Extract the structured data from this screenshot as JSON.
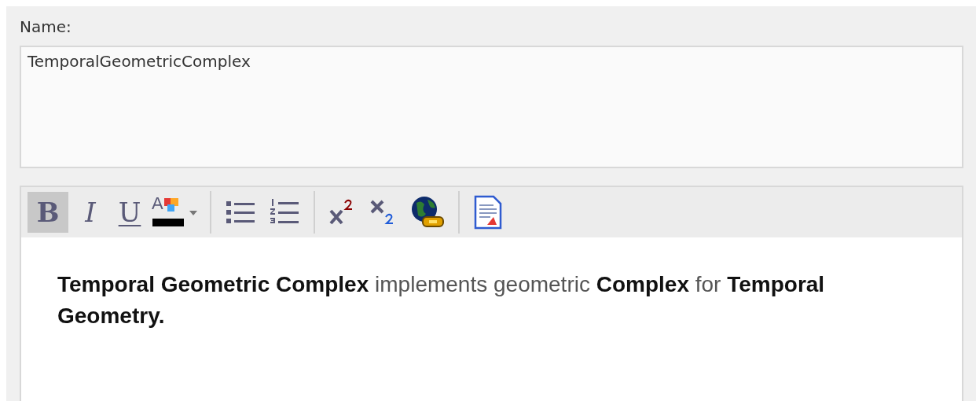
{
  "name_label": "Name:",
  "name_field": {
    "value": "TemporalGeometricComplex"
  },
  "toolbar": [
    {
      "kind": "bold",
      "label": "B",
      "selected": true
    },
    {
      "kind": "italic",
      "label": "I",
      "selected": false
    },
    {
      "kind": "underline",
      "label": "U",
      "selected": false
    },
    {
      "kind": "color",
      "label": "A",
      "selected": false
    },
    {
      "kind": "separator"
    },
    {
      "kind": "bullets",
      "selected": false
    },
    {
      "kind": "numbering",
      "selected": false
    },
    {
      "kind": "separator"
    },
    {
      "kind": "superscript",
      "selected": false
    },
    {
      "kind": "subscript",
      "selected": false
    },
    {
      "kind": "hyperlink",
      "selected": false
    },
    {
      "kind": "separator"
    },
    {
      "kind": "document",
      "selected": false
    }
  ],
  "notes": "**Temporal Geometric Complex** implements geometric **Complex** for **Temporal Geometry.**"
}
